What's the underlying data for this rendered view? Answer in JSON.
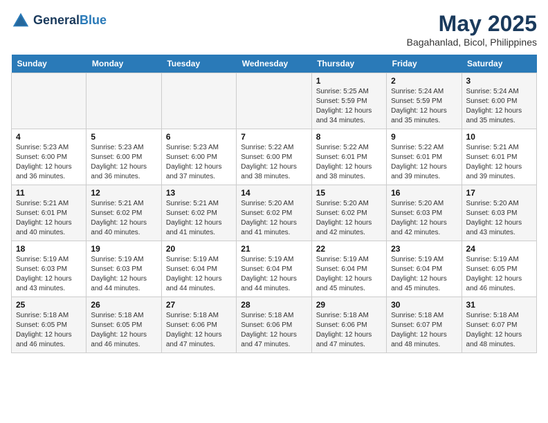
{
  "header": {
    "logo_line1": "General",
    "logo_line2": "Blue",
    "title": "May 2025",
    "subtitle": "Bagahanlad, Bicol, Philippines"
  },
  "weekdays": [
    "Sunday",
    "Monday",
    "Tuesday",
    "Wednesday",
    "Thursday",
    "Friday",
    "Saturday"
  ],
  "weeks": [
    [
      {
        "day": "",
        "info": ""
      },
      {
        "day": "",
        "info": ""
      },
      {
        "day": "",
        "info": ""
      },
      {
        "day": "",
        "info": ""
      },
      {
        "day": "1",
        "info": "Sunrise: 5:25 AM\nSunset: 5:59 PM\nDaylight: 12 hours\nand 34 minutes."
      },
      {
        "day": "2",
        "info": "Sunrise: 5:24 AM\nSunset: 5:59 PM\nDaylight: 12 hours\nand 35 minutes."
      },
      {
        "day": "3",
        "info": "Sunrise: 5:24 AM\nSunset: 6:00 PM\nDaylight: 12 hours\nand 35 minutes."
      }
    ],
    [
      {
        "day": "4",
        "info": "Sunrise: 5:23 AM\nSunset: 6:00 PM\nDaylight: 12 hours\nand 36 minutes."
      },
      {
        "day": "5",
        "info": "Sunrise: 5:23 AM\nSunset: 6:00 PM\nDaylight: 12 hours\nand 36 minutes."
      },
      {
        "day": "6",
        "info": "Sunrise: 5:23 AM\nSunset: 6:00 PM\nDaylight: 12 hours\nand 37 minutes."
      },
      {
        "day": "7",
        "info": "Sunrise: 5:22 AM\nSunset: 6:00 PM\nDaylight: 12 hours\nand 38 minutes."
      },
      {
        "day": "8",
        "info": "Sunrise: 5:22 AM\nSunset: 6:01 PM\nDaylight: 12 hours\nand 38 minutes."
      },
      {
        "day": "9",
        "info": "Sunrise: 5:22 AM\nSunset: 6:01 PM\nDaylight: 12 hours\nand 39 minutes."
      },
      {
        "day": "10",
        "info": "Sunrise: 5:21 AM\nSunset: 6:01 PM\nDaylight: 12 hours\nand 39 minutes."
      }
    ],
    [
      {
        "day": "11",
        "info": "Sunrise: 5:21 AM\nSunset: 6:01 PM\nDaylight: 12 hours\nand 40 minutes."
      },
      {
        "day": "12",
        "info": "Sunrise: 5:21 AM\nSunset: 6:02 PM\nDaylight: 12 hours\nand 40 minutes."
      },
      {
        "day": "13",
        "info": "Sunrise: 5:21 AM\nSunset: 6:02 PM\nDaylight: 12 hours\nand 41 minutes."
      },
      {
        "day": "14",
        "info": "Sunrise: 5:20 AM\nSunset: 6:02 PM\nDaylight: 12 hours\nand 41 minutes."
      },
      {
        "day": "15",
        "info": "Sunrise: 5:20 AM\nSunset: 6:02 PM\nDaylight: 12 hours\nand 42 minutes."
      },
      {
        "day": "16",
        "info": "Sunrise: 5:20 AM\nSunset: 6:03 PM\nDaylight: 12 hours\nand 42 minutes."
      },
      {
        "day": "17",
        "info": "Sunrise: 5:20 AM\nSunset: 6:03 PM\nDaylight: 12 hours\nand 43 minutes."
      }
    ],
    [
      {
        "day": "18",
        "info": "Sunrise: 5:19 AM\nSunset: 6:03 PM\nDaylight: 12 hours\nand 43 minutes."
      },
      {
        "day": "19",
        "info": "Sunrise: 5:19 AM\nSunset: 6:03 PM\nDaylight: 12 hours\nand 44 minutes."
      },
      {
        "day": "20",
        "info": "Sunrise: 5:19 AM\nSunset: 6:04 PM\nDaylight: 12 hours\nand 44 minutes."
      },
      {
        "day": "21",
        "info": "Sunrise: 5:19 AM\nSunset: 6:04 PM\nDaylight: 12 hours\nand 44 minutes."
      },
      {
        "day": "22",
        "info": "Sunrise: 5:19 AM\nSunset: 6:04 PM\nDaylight: 12 hours\nand 45 minutes."
      },
      {
        "day": "23",
        "info": "Sunrise: 5:19 AM\nSunset: 6:04 PM\nDaylight: 12 hours\nand 45 minutes."
      },
      {
        "day": "24",
        "info": "Sunrise: 5:19 AM\nSunset: 6:05 PM\nDaylight: 12 hours\nand 46 minutes."
      }
    ],
    [
      {
        "day": "25",
        "info": "Sunrise: 5:18 AM\nSunset: 6:05 PM\nDaylight: 12 hours\nand 46 minutes."
      },
      {
        "day": "26",
        "info": "Sunrise: 5:18 AM\nSunset: 6:05 PM\nDaylight: 12 hours\nand 46 minutes."
      },
      {
        "day": "27",
        "info": "Sunrise: 5:18 AM\nSunset: 6:06 PM\nDaylight: 12 hours\nand 47 minutes."
      },
      {
        "day": "28",
        "info": "Sunrise: 5:18 AM\nSunset: 6:06 PM\nDaylight: 12 hours\nand 47 minutes."
      },
      {
        "day": "29",
        "info": "Sunrise: 5:18 AM\nSunset: 6:06 PM\nDaylight: 12 hours\nand 47 minutes."
      },
      {
        "day": "30",
        "info": "Sunrise: 5:18 AM\nSunset: 6:07 PM\nDaylight: 12 hours\nand 48 minutes."
      },
      {
        "day": "31",
        "info": "Sunrise: 5:18 AM\nSunset: 6:07 PM\nDaylight: 12 hours\nand 48 minutes."
      }
    ]
  ]
}
